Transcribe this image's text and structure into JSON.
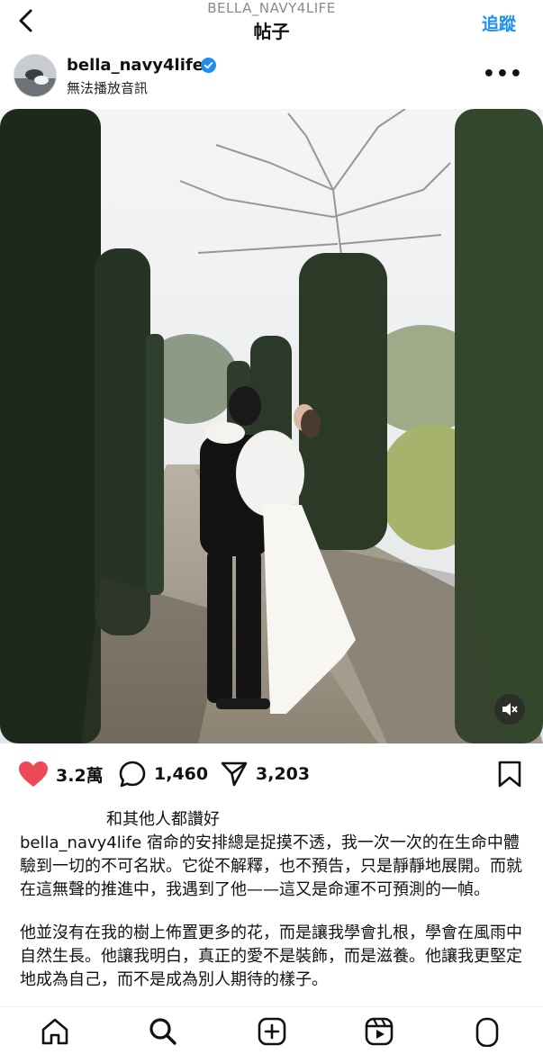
{
  "header": {
    "username": "BELLA_NAVY4LIFE",
    "title": "帖子",
    "follow_label": "追蹤"
  },
  "post": {
    "username": "bella_navy4life",
    "subtitle": "無法播放音訊"
  },
  "actions": {
    "likes": "3.2萬",
    "comments": "1,460",
    "shares": "3,203"
  },
  "liked_by": "和其他人都讚好",
  "caption": {
    "username": "bella_navy4life",
    "paragraph1": "宿命的安排總是捉摸不透，我一次一次的在生命中體驗到一切的不可名狀。它從不解釋，也不預告，只是靜靜地展開。而就在這無聲的推進中，我遇到了他——這又是命運不可預測的一幀。",
    "paragraph2": "他並沒有在我的樹上佈置更多的花，而是讓我學會扎根，學會在風雨中自然生長。他讓我明白，真正的愛不是裝飾，而是滋養。他讓我更堅定地成為自己，而不是成為別人期待的樣子。"
  },
  "colors": {
    "accent": "#1c8ff1",
    "like": "#ed4956"
  }
}
